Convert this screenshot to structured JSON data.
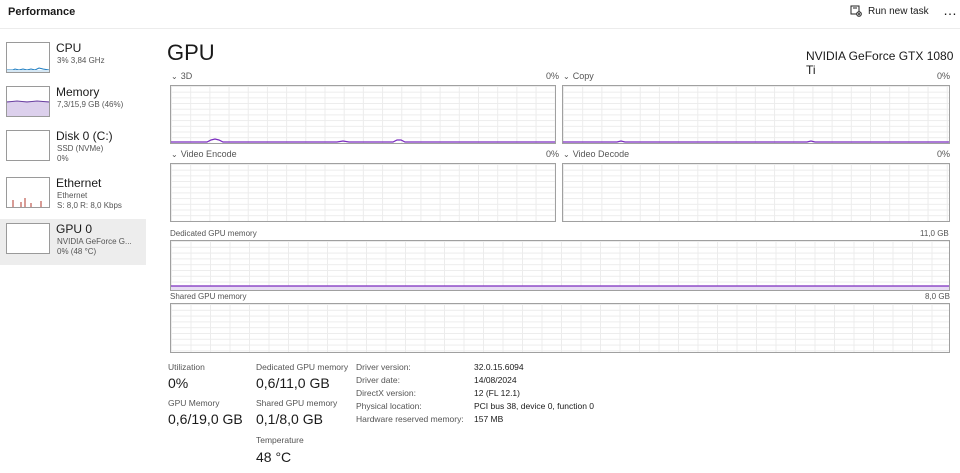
{
  "header": {
    "title": "Performance",
    "run_new_task": "Run new task",
    "more": "…"
  },
  "sidebar": {
    "items": [
      {
        "name": "CPU",
        "sub1": "3%  3,84 GHz",
        "sub2": "",
        "sub3": ""
      },
      {
        "name": "Memory",
        "sub1": "7,3/15,9 GB (46%)",
        "sub2": "",
        "sub3": ""
      },
      {
        "name": "Disk 0 (C:)",
        "sub1": "SSD (NVMe)",
        "sub2": "0%",
        "sub3": ""
      },
      {
        "name": "Ethernet",
        "sub1": "Ethernet",
        "sub2": "S: 8,0  R: 8,0 Kbps",
        "sub3": ""
      },
      {
        "name": "GPU 0",
        "sub1": "NVIDIA GeForce G...",
        "sub2": "0% (48 °C)",
        "sub3": ""
      }
    ]
  },
  "main": {
    "title": "GPU",
    "gpu_model": "NVIDIA GeForce GTX 1080 Ti",
    "engines": [
      {
        "label": "3D",
        "value": "0%"
      },
      {
        "label": "Copy",
        "value": "0%"
      },
      {
        "label": "Video Encode",
        "value": "0%"
      },
      {
        "label": "Video Decode",
        "value": "0%"
      }
    ],
    "dedicated_graph": {
      "label": "Dedicated GPU memory",
      "max": "11,0 GB"
    },
    "shared_graph": {
      "label": "Shared GPU memory",
      "max": "8,0 GB"
    },
    "stats": {
      "utilization_label": "Utilization",
      "utilization_value": "0%",
      "gpu_memory_label": "GPU Memory",
      "gpu_memory_value": "0,6/19,0 GB",
      "dedicated_label": "Dedicated GPU memory",
      "dedicated_value": "0,6/11,0 GB",
      "shared_label": "Shared GPU memory",
      "shared_value": "0,1/8,0 GB",
      "temperature_label": "Temperature",
      "temperature_value": "48 °C"
    },
    "info": [
      {
        "label": "Driver version:",
        "value": "32.0.15.6094"
      },
      {
        "label": "Driver date:",
        "value": "14/08/2024"
      },
      {
        "label": "DirectX version:",
        "value": "12 (FL 12.1)"
      },
      {
        "label": "Physical location:",
        "value": "PCI bus 38, device 0, function 0"
      },
      {
        "label": "Hardware reserved memory:",
        "value": "157 MB"
      }
    ]
  },
  "colors": {
    "cpu": "#1b7cc1",
    "memory": "#6a3fa0",
    "disk": "#4e9a06",
    "ethernet": "#b03a2e",
    "gpu": "#7b2cbf"
  }
}
